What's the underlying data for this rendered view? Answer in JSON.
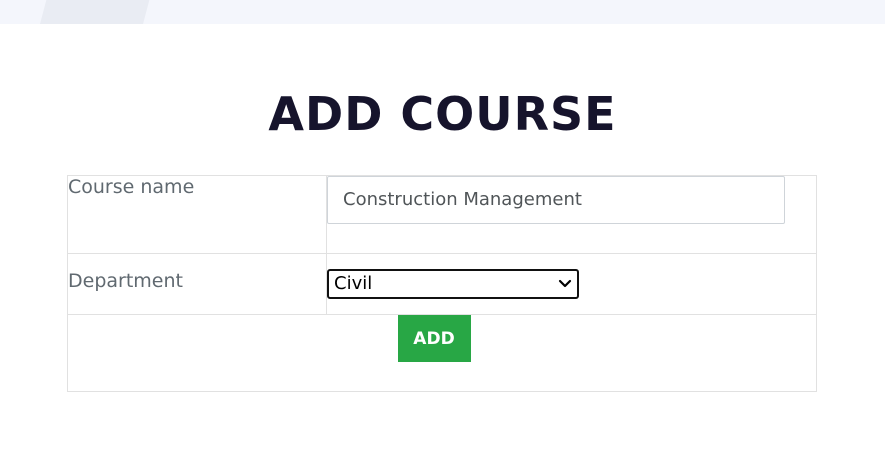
{
  "page": {
    "title": "ADD COURSE"
  },
  "form": {
    "course_name": {
      "label": "Course name",
      "value": "Construction Management"
    },
    "department": {
      "label": "Department",
      "selected": "Civil"
    },
    "submit_label": "ADD"
  },
  "colors": {
    "title": "#16142c",
    "button_bg": "#28a745",
    "top_band": "#f4f6fc"
  },
  "icons": {
    "select_arrow": "chevron-down-icon"
  }
}
